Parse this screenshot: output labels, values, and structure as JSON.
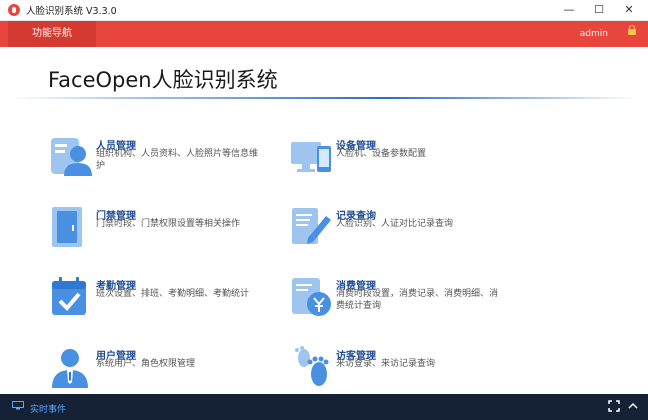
{
  "window": {
    "title": "人脸识别系统 V3.3.0",
    "minimize": "—",
    "maximize": "☐",
    "close": "✕"
  },
  "nav": {
    "tab_label": "功能导航",
    "user": "admin"
  },
  "header": {
    "title": "FaceOpen人脸识别系统"
  },
  "modules": [
    {
      "title": "人员管理",
      "desc": "组织机构、人员资料、人脸照片等信息维护",
      "icon": "person-card-icon"
    },
    {
      "title": "设备管理",
      "desc": "人脸机、设备参数配置",
      "icon": "monitor-phone-icon"
    },
    {
      "title": "门禁管理",
      "desc": "门禁时段、门禁权限设置等相关操作",
      "icon": "door-icon"
    },
    {
      "title": "记录查询",
      "desc": "人脸识别、人证对比记录查询",
      "icon": "document-pen-icon"
    },
    {
      "title": "考勤管理",
      "desc": "班次设置、排班、考勤明细、考勤统计",
      "icon": "calendar-check-icon"
    },
    {
      "title": "消费管理",
      "desc": "消费时段设置，消费记录、消费明细、消费统计查询",
      "icon": "receipt-yen-icon"
    },
    {
      "title": "用户管理",
      "desc": "系统用户、角色权限管理",
      "icon": "user-tie-icon"
    },
    {
      "title": "访客管理",
      "desc": "来访登录、来访记录查询",
      "icon": "footprint-icon"
    }
  ],
  "status": {
    "text": "实时事件"
  },
  "colors": {
    "accent": "#e8453c",
    "icon_blue": "#4a90e2",
    "title_blue": "#1f4e96",
    "statusbar": "#152236"
  }
}
